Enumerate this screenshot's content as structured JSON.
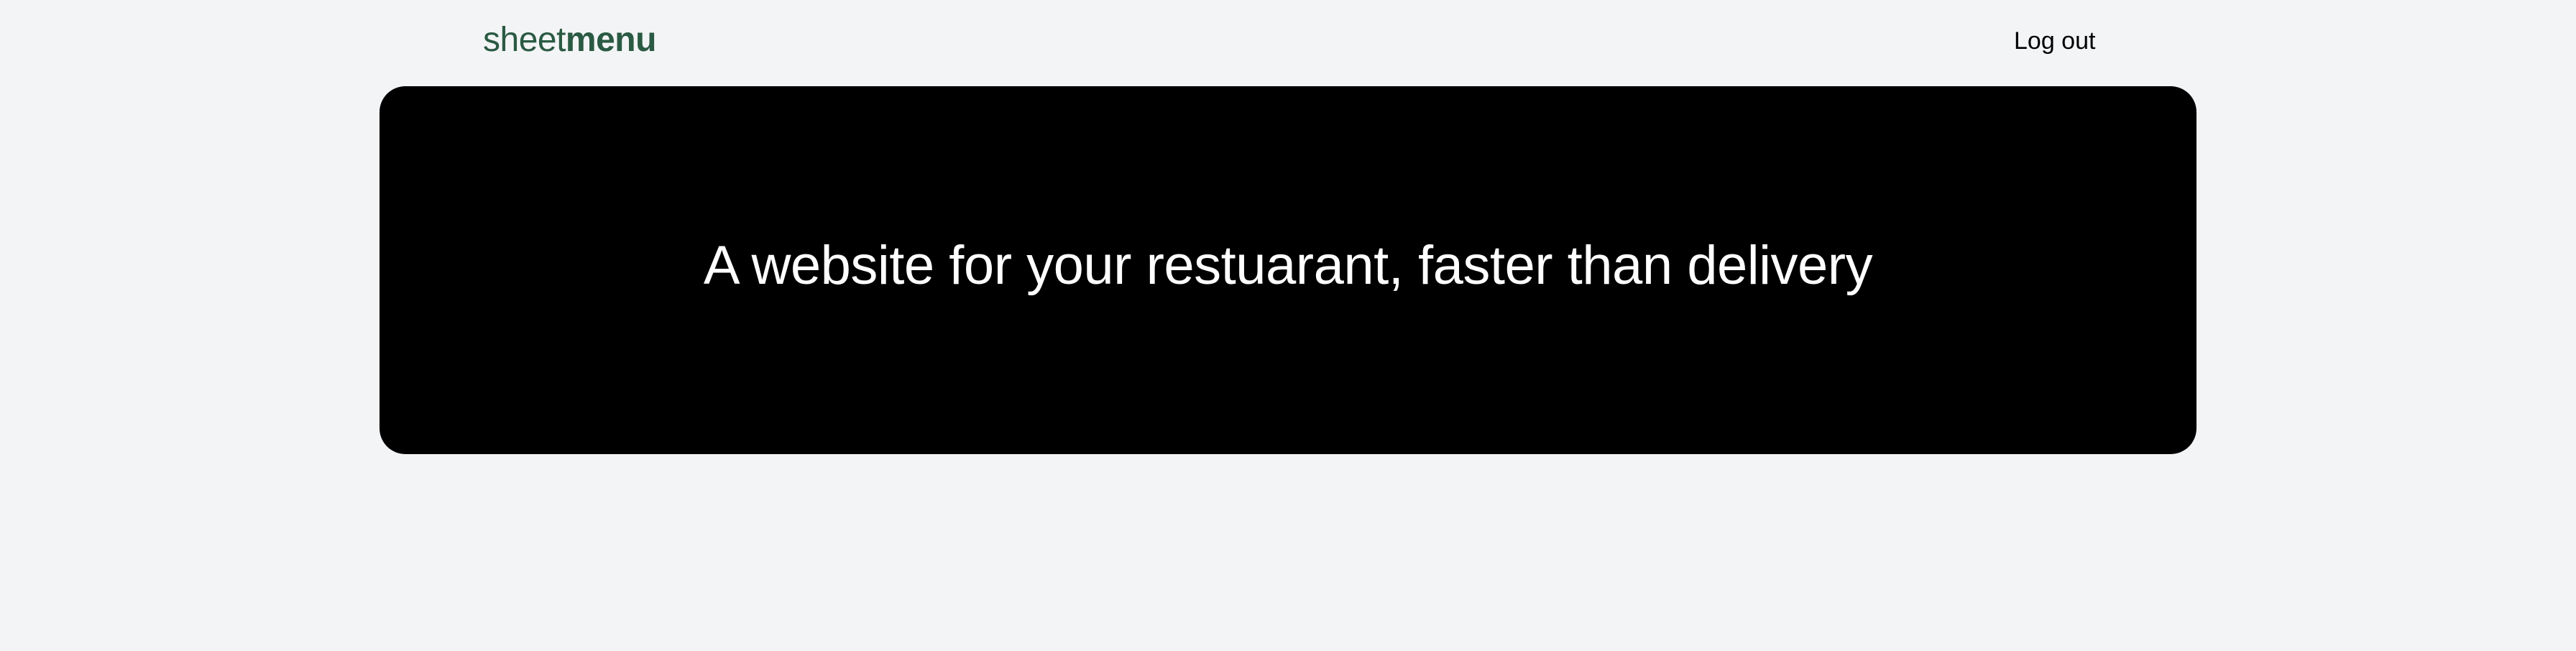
{
  "header": {
    "logo_light": "sheet",
    "logo_bold": "menu",
    "logout_label": "Log out"
  },
  "hero": {
    "title": "A website for your restuarant, faster than delivery"
  },
  "colors": {
    "background": "#f3f4f6",
    "brand_green": "#2a5a43",
    "hero_background": "#000000",
    "hero_text": "#ffffff"
  }
}
